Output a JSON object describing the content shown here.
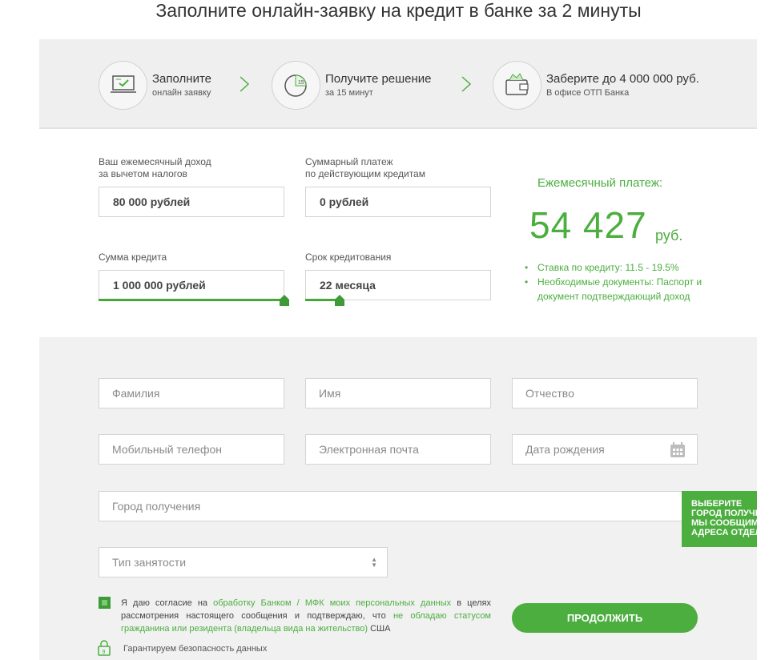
{
  "page": {
    "title": "Заполните онлайн-заявку на кредит в банке за 2 минуты"
  },
  "steps": [
    {
      "title": "Заполните",
      "subtitle": "онлайн заявку",
      "icon": "laptop-check-icon"
    },
    {
      "title": "Получите решение",
      "subtitle": "за 15 минут",
      "icon": "clock-15-icon"
    },
    {
      "title": "Заберите до 4 000 000 руб.",
      "subtitle": "В офисе ОТП Банка",
      "icon": "wallet-icon"
    }
  ],
  "calculator": {
    "income": {
      "label_line1": "Ваш ежемесячный доход",
      "label_line2": "за вычетом налогов",
      "value": "80 000 рублей"
    },
    "payments": {
      "label_line1": "Суммарный платеж",
      "label_line2": "по действующим кредитам",
      "value": "0 рублей"
    },
    "amount": {
      "label": "Сумма кредита",
      "value": "1 000 000 рублей",
      "slider_fraction": 1.0
    },
    "term": {
      "label": "Срок кредитования",
      "value": "22 месяца",
      "slider_fraction": 0.18
    }
  },
  "result": {
    "title": "Ежемесячный платеж:",
    "amount": "54 427",
    "unit": "руб.",
    "bullets": [
      "Ставка по кредиту: 11.5 - 19.5%",
      "Необходимые документы: Паспорт и документ подтверждающий доход"
    ]
  },
  "form": {
    "surname_placeholder": "Фамилия",
    "name_placeholder": "Имя",
    "patronymic_placeholder": "Отчество",
    "phone_placeholder": "Мобильный телефон",
    "email_placeholder": "Электронная почта",
    "birthdate_placeholder": "Дата рождения",
    "city_placeholder": "Город получения",
    "employment_placeholder": "Тип занятости",
    "tooltip_lines": [
      "ВЫБЕРИТЕ",
      "ГОРОД ПОЛУЧЕ",
      "МЫ СООБЩИМ",
      "АДРЕСА ОТДЕЛ"
    ]
  },
  "consent": {
    "checked": true,
    "part1": "Я даю согласие на ",
    "link1": "обработку Банком / МФК моих персональных данных",
    "part2": " в целях рассмотрения настоящего сообщения и подтверждаю, что ",
    "link2": "не обладаю статусом гражданина или резидента (владельца вида на жительство)",
    "part3": " США"
  },
  "submit_label": "ПРОДОЛЖИТЬ",
  "security_note": "Гарантируем безопасность данных",
  "colors": {
    "accent": "#4cae3f",
    "band": "#efefef",
    "form_band": "#f1f1f1"
  }
}
